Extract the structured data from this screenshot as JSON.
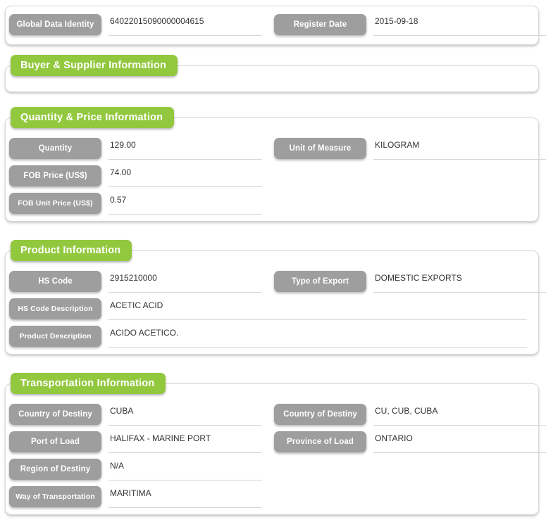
{
  "theme": {
    "accent_green": "#92c83e",
    "label_gray": "#9e9e9e",
    "value_text": "#333333",
    "panel_bg": "#ffffff"
  },
  "sections": [
    {
      "id": "identity",
      "title": null,
      "fields": [
        {
          "label": "Global Data Identity",
          "value": "64022015090000004615",
          "column": "left",
          "width": "half"
        },
        {
          "label": "Register Date",
          "value": "2015-09-18",
          "column": "right",
          "width": "right"
        }
      ]
    },
    {
      "id": "buyer-supplier",
      "title": "Buyer & Supplier Information",
      "fields": []
    },
    {
      "id": "quantity-price",
      "title": "Quantity & Price Information",
      "fields": [
        {
          "label": "Quantity",
          "value": "129.00",
          "column": "left",
          "width": "half"
        },
        {
          "label": "Unit of Measure",
          "value": "KILOGRAM",
          "column": "right",
          "width": "right"
        },
        {
          "label": "FOB Price (US$)",
          "value": "74.00",
          "column": "left",
          "width": "half"
        },
        {
          "label": "FOB Unit Price (US$)",
          "value": "0.57",
          "column": "left",
          "width": "half"
        }
      ]
    },
    {
      "id": "product",
      "title": "Product Information",
      "fields": [
        {
          "label": "HS Code",
          "value": "2915210000",
          "column": "left",
          "width": "half"
        },
        {
          "label": "Type of Export",
          "value": "DOMESTIC EXPORTS",
          "column": "right",
          "width": "right"
        },
        {
          "label": "HS Code Description",
          "value": "ACETIC ACID",
          "column": "left",
          "width": "full"
        },
        {
          "label": "Product Description",
          "value": "ACIDO ACETICO.",
          "column": "left",
          "width": "full"
        }
      ]
    },
    {
      "id": "transportation",
      "title": "Transportation Information",
      "fields": [
        {
          "label": "Country of Destiny",
          "value": "CUBA",
          "column": "left",
          "width": "half"
        },
        {
          "label": "Country of Destiny",
          "value": "CU, CUB, CUBA",
          "column": "right",
          "width": "right"
        },
        {
          "label": "Port of Load",
          "value": "HALIFAX - MARINE PORT",
          "column": "left",
          "width": "half"
        },
        {
          "label": "Province of Load",
          "value": "ONTARIO",
          "column": "right",
          "width": "right"
        },
        {
          "label": "Region of Destiny",
          "value": "N/A",
          "column": "left",
          "width": "half"
        },
        {
          "label": "Way of Transportation",
          "value": "MARITIMA",
          "column": "left",
          "width": "half"
        }
      ]
    }
  ]
}
